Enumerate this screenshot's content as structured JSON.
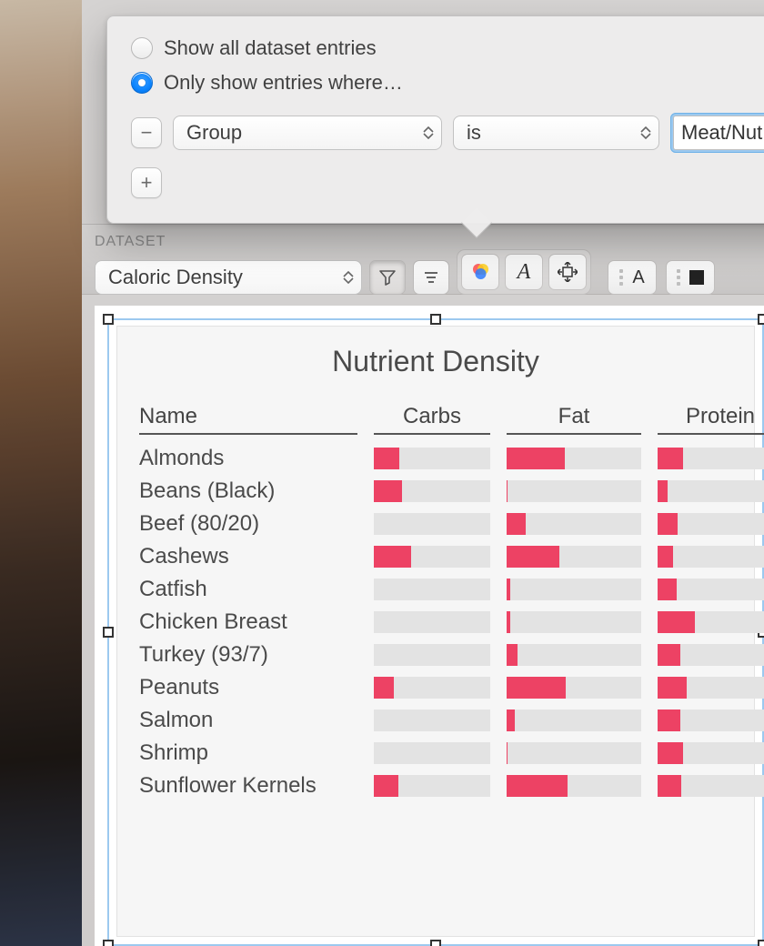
{
  "popover": {
    "radio_show_all": "Show all dataset entries",
    "radio_only_show": "Only show entries where…",
    "selected": "only_show",
    "filter": {
      "field": "Group",
      "operator": "is",
      "value": "Meat/Nut"
    }
  },
  "toolbar": {
    "dataset_label": "DATASET",
    "dataset_value": "Caloric Density"
  },
  "chart": {
    "title": "Nutrient Density",
    "columns": [
      "Name",
      "Carbs",
      "Fat",
      "Protein"
    ]
  },
  "chart_data": {
    "type": "table",
    "title": "Nutrient Density",
    "value_scale": "0–1 fraction of cell width",
    "columns": [
      "Name",
      "Carbs",
      "Fat",
      "Protein"
    ],
    "rows": [
      {
        "name": "Almonds",
        "carbs": 0.22,
        "fat": 0.43,
        "protein": 0.2
      },
      {
        "name": "Beans (Black)",
        "carbs": 0.24,
        "fat": 0.01,
        "protein": 0.08
      },
      {
        "name": "Beef (80/20)",
        "carbs": 0.0,
        "fat": 0.14,
        "protein": 0.16
      },
      {
        "name": "Cashews",
        "carbs": 0.32,
        "fat": 0.39,
        "protein": 0.12
      },
      {
        "name": "Catfish",
        "carbs": 0.0,
        "fat": 0.03,
        "protein": 0.15
      },
      {
        "name": "Chicken Breast",
        "carbs": 0.0,
        "fat": 0.03,
        "protein": 0.3
      },
      {
        "name": "Turkey (93/7)",
        "carbs": 0.0,
        "fat": 0.08,
        "protein": 0.18
      },
      {
        "name": "Peanuts",
        "carbs": 0.17,
        "fat": 0.44,
        "protein": 0.23
      },
      {
        "name": "Salmon",
        "carbs": 0.0,
        "fat": 0.06,
        "protein": 0.18
      },
      {
        "name": "Shrimp",
        "carbs": 0.0,
        "fat": 0.01,
        "protein": 0.2
      },
      {
        "name": "Sunflower Kernels",
        "carbs": 0.21,
        "fat": 0.45,
        "protein": 0.19
      }
    ]
  }
}
